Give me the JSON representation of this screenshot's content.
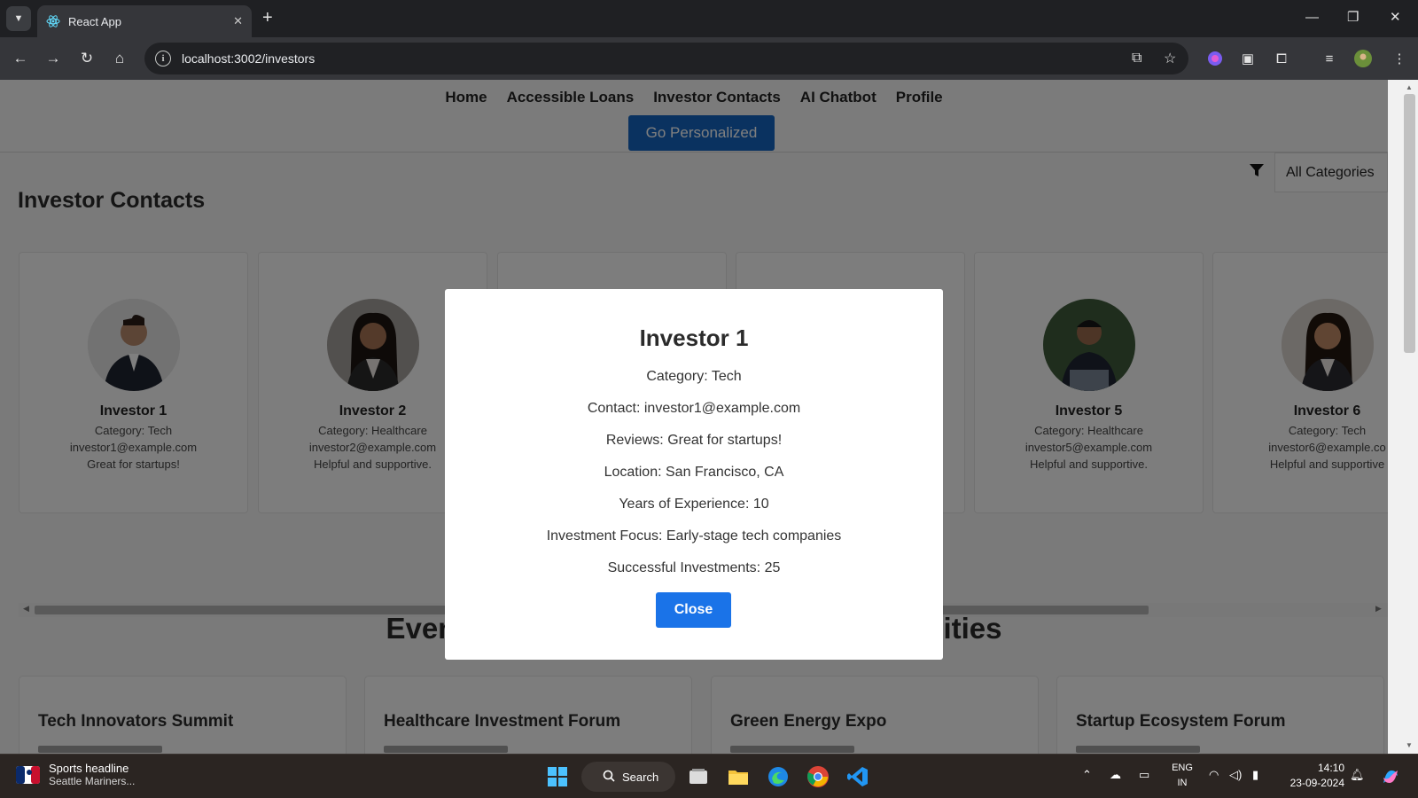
{
  "browser": {
    "tab_title": "React App",
    "url": "localhost:3002/investors"
  },
  "nav": {
    "links": [
      "Home",
      "Accessible Loans",
      "Investor Contacts",
      "AI Chatbot",
      "Profile"
    ],
    "cta": "Go Personalized"
  },
  "filter": {
    "selected": "All Categories"
  },
  "page_title": "Investor Contacts",
  "investors": [
    {
      "name": "Investor 1",
      "category": "Category: Tech",
      "email": "investor1@example.com",
      "review": "Great for startups!"
    },
    {
      "name": "Investor 2",
      "category": "Category: Healthcare",
      "email": "investor2@example.com",
      "review": "Helpful and supportive."
    },
    {
      "name": "Investor 5",
      "category": "Category: Healthcare",
      "email": "investor5@example.com",
      "review": "Helpful and supportive."
    },
    {
      "name": "Investor 6",
      "category": "Category: Tech",
      "email": "investor6@example.co",
      "review": "Helpful and supportive"
    }
  ],
  "events": {
    "heading_left": "Even",
    "heading_right": "nities",
    "items": [
      "Tech Innovators Summit",
      "Healthcare Investment Forum",
      "Green Energy Expo",
      "Startup Ecosystem Forum"
    ]
  },
  "modal": {
    "title": "Investor 1",
    "category": "Category: Tech",
    "contact": "Contact: investor1@example.com",
    "reviews": "Reviews: Great for startups!",
    "location": "Location: San Francisco, CA",
    "experience": "Years of Experience: 10",
    "focus": "Investment Focus: Early-stage tech companies",
    "successful": "Successful Investments: 25",
    "close_label": "Close"
  },
  "taskbar": {
    "news_title": "Sports headline",
    "news_sub": "Seattle Mariners...",
    "search_label": "Search",
    "lang_top": "ENG",
    "lang_bottom": "IN",
    "time": "14:10",
    "date": "23-09-2024"
  },
  "colors": {
    "primary": "#1565c0",
    "close_button": "#1a73e8",
    "overlay": "#000000"
  }
}
